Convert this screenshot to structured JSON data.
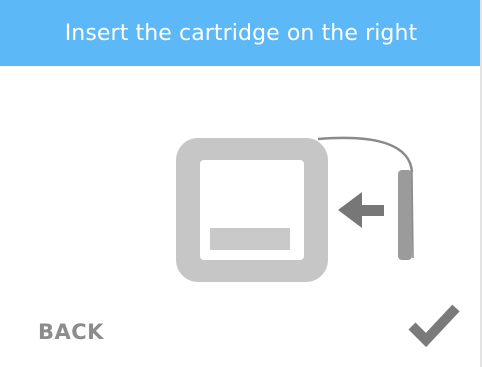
{
  "header": {
    "title": "Insert the cartridge on the right"
  },
  "illustration": {
    "cartridge_icon": "cartridge-icon",
    "arrow_icon": "arrow-left-icon",
    "slot_icon": "slot-icon",
    "arrow_color": "#777777",
    "cartridge_color": "#c6c6c6"
  },
  "footer": {
    "back_label": "BACK",
    "confirm_icon": "checkmark-icon"
  },
  "colors": {
    "header_bg": "#5cb8f6",
    "header_text": "#ffffff",
    "back_text": "#8c8c8c",
    "check": "#7a7a7a"
  }
}
